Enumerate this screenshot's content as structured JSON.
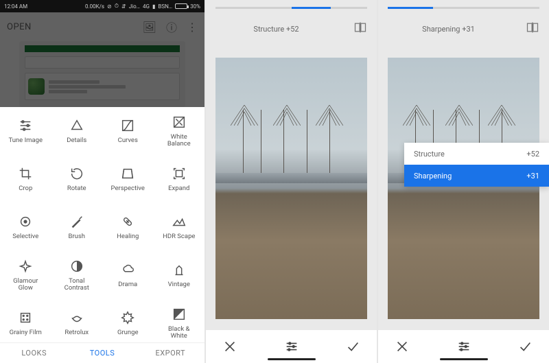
{
  "status": {
    "time": "12:04 AM",
    "speed": "0.00K/s",
    "net1": "Jio…",
    "sig": "4G",
    "net2": "BSN…",
    "battery": "30%"
  },
  "open_label": "OPEN",
  "tools": [
    {
      "id": "tune-image",
      "label": "Tune Image"
    },
    {
      "id": "details",
      "label": "Details"
    },
    {
      "id": "curves",
      "label": "Curves"
    },
    {
      "id": "white-balance",
      "label": "White\nBalance"
    },
    {
      "id": "crop",
      "label": "Crop"
    },
    {
      "id": "rotate",
      "label": "Rotate"
    },
    {
      "id": "perspective",
      "label": "Perspective"
    },
    {
      "id": "expand",
      "label": "Expand"
    },
    {
      "id": "selective",
      "label": "Selective"
    },
    {
      "id": "brush",
      "label": "Brush"
    },
    {
      "id": "healing",
      "label": "Healing"
    },
    {
      "id": "hdr-scape",
      "label": "HDR Scape"
    },
    {
      "id": "glamour-glow",
      "label": "Glamour\nGlow"
    },
    {
      "id": "tonal-contrast",
      "label": "Tonal\nContrast"
    },
    {
      "id": "drama",
      "label": "Drama"
    },
    {
      "id": "vintage",
      "label": "Vintage"
    },
    {
      "id": "grainy-film",
      "label": "Grainy Film"
    },
    {
      "id": "retrolux",
      "label": "Retrolux"
    },
    {
      "id": "grunge",
      "label": "Grunge"
    },
    {
      "id": "black-white",
      "label": "Black &\nWhite"
    }
  ],
  "tabs": {
    "looks": "LOOKS",
    "tools": "TOOLS",
    "export": "EXPORT"
  },
  "panel2": {
    "readout": "Structure +52",
    "slider_start_pct": 50,
    "slider_len_pct": 26
  },
  "panel3": {
    "readout": "Sharpening +31",
    "slider_start_pct": 0,
    "slider_len_pct": 30,
    "menu": [
      {
        "label": "Structure",
        "value": "+52",
        "selected": false
      },
      {
        "label": "Sharpening",
        "value": "+31",
        "selected": true
      }
    ]
  }
}
